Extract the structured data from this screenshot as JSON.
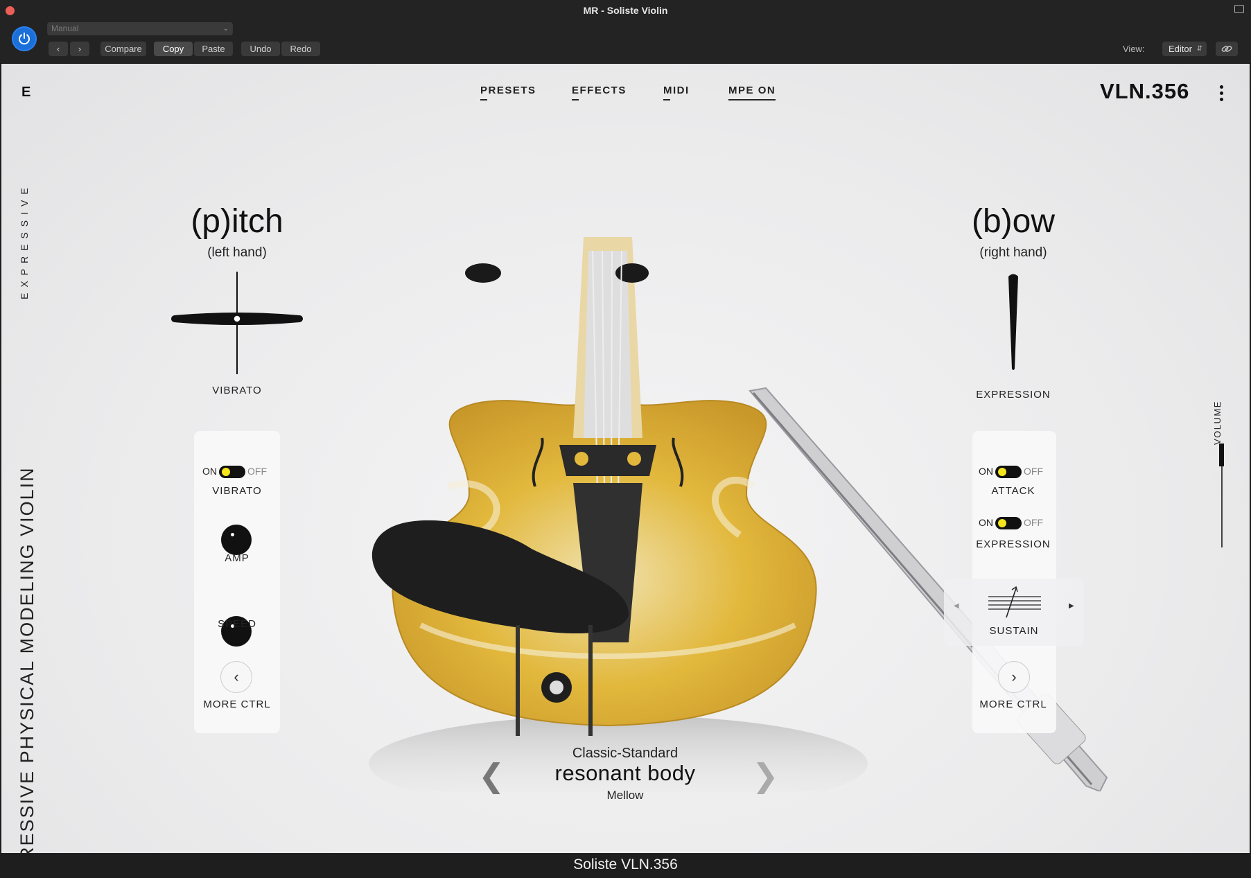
{
  "window": {
    "title": "MR - Soliste Violin"
  },
  "host": {
    "preset_select": "Manual",
    "compare": "Compare",
    "copy": "Copy",
    "paste": "Paste",
    "undo": "Undo",
    "redo": "Redo",
    "view_label": "View:",
    "view_value": "Editor"
  },
  "plugin": {
    "tabs": {
      "presets": "PRESETS",
      "effects": "EFFECTS",
      "midi": "MIDI",
      "mpe": "MPE",
      "mpe_state": "ON"
    },
    "product_name": "VLN.356",
    "brand_vertical": "EXPRESSIVE",
    "brand_logo": "E",
    "side_vertical": "EXPRESSIVE PHYSICAL MODELING VIOLIN",
    "pitch": {
      "title": "(p)itch",
      "subtitle": "(left hand)",
      "xy_label": "VIBRATO",
      "toggle_on": "ON",
      "toggle_off": "OFF",
      "toggle_label": "VIBRATO",
      "knob1": "AMP",
      "knob2": "SPEED",
      "more": "MORE CTRL"
    },
    "bow": {
      "title": "(b)ow",
      "subtitle": "(right hand)",
      "fader_label": "EXPRESSION",
      "toggle1_on": "ON",
      "toggle1_off": "OFF",
      "toggle1_label": "ATTACK",
      "toggle2_on": "ON",
      "toggle2_off": "OFF",
      "toggle2_label": "EXPRESSION",
      "sustain_label": "SUSTAIN",
      "more": "MORE CTRL"
    },
    "volume_label": "VOLUME",
    "preset": {
      "category": "Classic-Standard",
      "name": "resonant body",
      "variant": "Mellow"
    },
    "footer": "Soliste VLN.356",
    "colors": {
      "toggle_dot": "#f5e51c",
      "power": "#1a6fd8",
      "violin_yellow": "#e2b83c"
    }
  }
}
